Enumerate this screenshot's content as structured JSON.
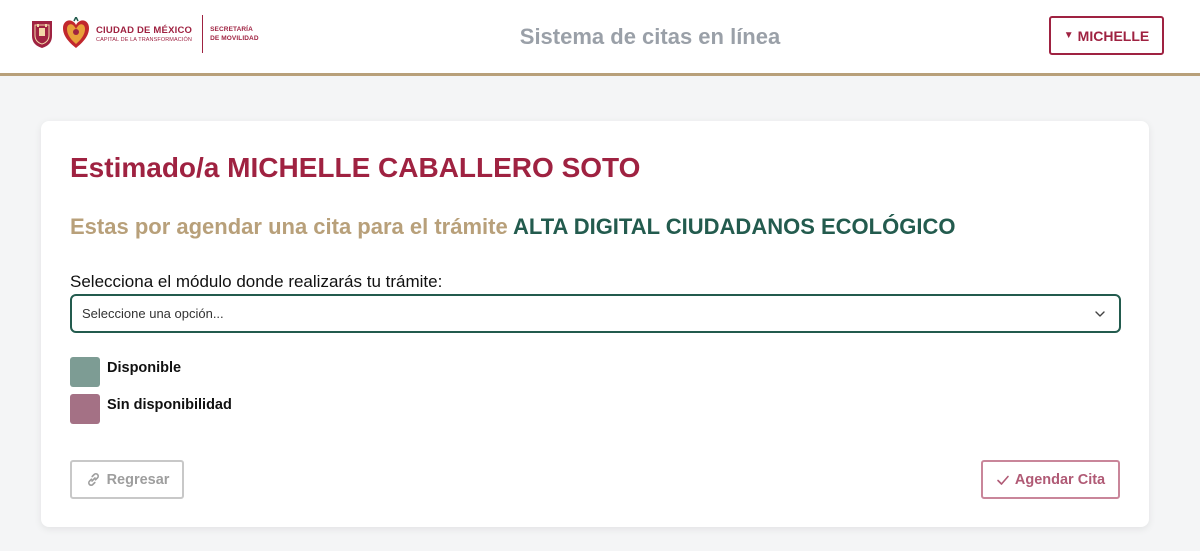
{
  "header": {
    "brand_main": "CIUDAD DE MÉXICO",
    "brand_sub": "CAPITAL DE LA TRANSFORMACIÓN",
    "secretaria_line1": "SECRETARÍA",
    "secretaria_line2": "DE MOVILIDAD",
    "app_title": "Sistema de citas en línea",
    "user_menu_label": "MICHELLE"
  },
  "main": {
    "greeting": "Estimado/a MICHELLE CABALLERO SOTO",
    "tramite_prefix": "Estas por agendar una cita para el trámite",
    "tramite_name": "ALTA DIGITAL CIUDADANOS ECOLÓGICO",
    "modulo_label": "Selecciona el módulo donde realizarás tu trámite:",
    "modulo_select": {
      "selected": "Seleccione una opción..."
    },
    "legend": [
      {
        "label": "Disponible",
        "color": "#7d9c94"
      },
      {
        "label": "Sin disponibilidad",
        "color": "#a47185"
      }
    ],
    "back_button": "Regresar",
    "schedule_button": "Agendar Cita"
  },
  "colors": {
    "brand_primary": "#9f2241",
    "brand_gold": "#b8a07a",
    "brand_green": "#235b4e"
  },
  "icons": {
    "user_caret": "caret-down-icon",
    "select_chevron": "chevron-down-icon",
    "back": "link-icon",
    "schedule": "check-icon"
  }
}
